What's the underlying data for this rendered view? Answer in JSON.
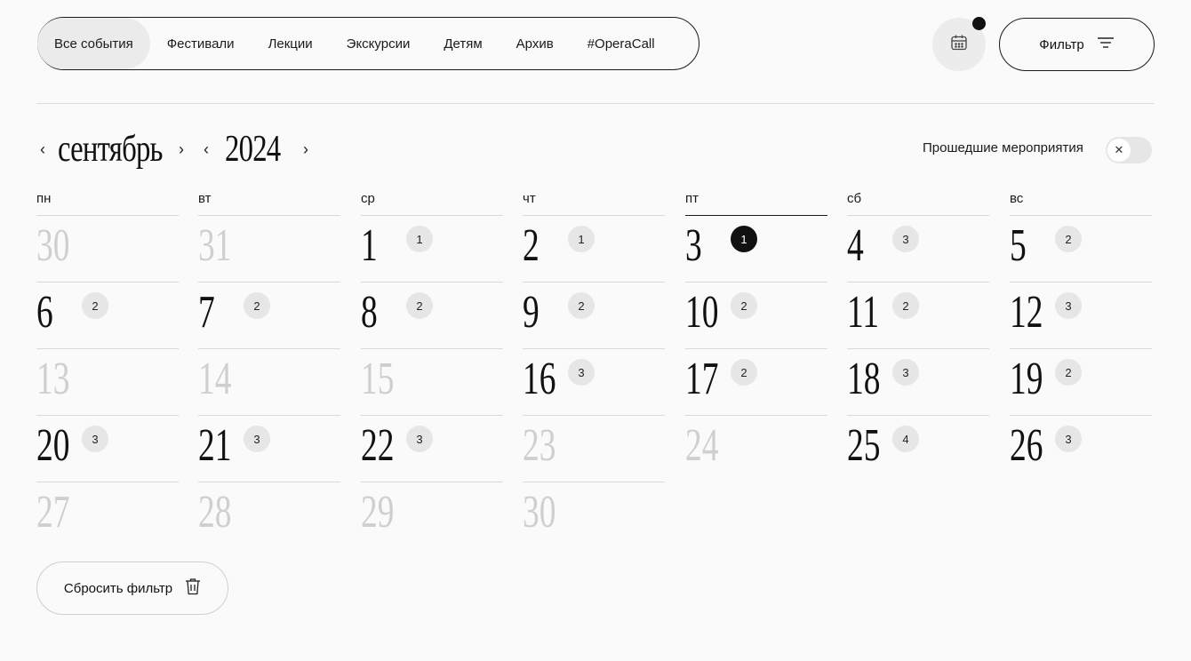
{
  "tabs": [
    {
      "label": "Все события",
      "active": true
    },
    {
      "label": "Фестивали",
      "active": false
    },
    {
      "label": "Лекции",
      "active": false
    },
    {
      "label": "Экскурсии",
      "active": false
    },
    {
      "label": "Детям",
      "active": false
    },
    {
      "label": "Архив",
      "active": false
    },
    {
      "label": "#OperaCall",
      "active": false
    }
  ],
  "filter_label": "Фильтр",
  "calendar_icon": "calendar-icon",
  "month": "сентябрь",
  "year": "2024",
  "past_events_label": "Прошедшие мероприятия",
  "past_events_toggle": "off",
  "weekdays": [
    "пн",
    "вт",
    "ср",
    "чт",
    "пт",
    "сб",
    "вс"
  ],
  "weeks": [
    [
      {
        "day": "30",
        "dim": true,
        "count": ""
      },
      {
        "day": "31",
        "dim": true,
        "count": ""
      },
      {
        "day": "1",
        "dim": false,
        "count": "1"
      },
      {
        "day": "2",
        "dim": false,
        "count": "1"
      },
      {
        "day": "3",
        "dim": false,
        "count": "1",
        "active": true
      },
      {
        "day": "4",
        "dim": false,
        "count": "3"
      },
      {
        "day": "5",
        "dim": false,
        "count": "2"
      }
    ],
    [
      {
        "day": "6",
        "dim": false,
        "count": "2"
      },
      {
        "day": "7",
        "dim": false,
        "count": "2"
      },
      {
        "day": "8",
        "dim": false,
        "count": "2"
      },
      {
        "day": "9",
        "dim": false,
        "count": "2"
      },
      {
        "day": "10",
        "dim": false,
        "count": "2"
      },
      {
        "day": "11",
        "dim": false,
        "count": "2"
      },
      {
        "day": "12",
        "dim": false,
        "count": "3"
      }
    ],
    [
      {
        "day": "13",
        "dim": true,
        "count": ""
      },
      {
        "day": "14",
        "dim": true,
        "count": ""
      },
      {
        "day": "15",
        "dim": true,
        "count": ""
      },
      {
        "day": "16",
        "dim": false,
        "count": "3"
      },
      {
        "day": "17",
        "dim": false,
        "count": "2"
      },
      {
        "day": "18",
        "dim": false,
        "count": "3"
      },
      {
        "day": "19",
        "dim": false,
        "count": "2"
      }
    ],
    [
      {
        "day": "20",
        "dim": false,
        "count": "3"
      },
      {
        "day": "21",
        "dim": false,
        "count": "3"
      },
      {
        "day": "22",
        "dim": false,
        "count": "3"
      },
      {
        "day": "23",
        "dim": true,
        "count": ""
      },
      {
        "day": "24",
        "dim": true,
        "count": ""
      },
      {
        "day": "25",
        "dim": false,
        "count": "4"
      },
      {
        "day": "26",
        "dim": false,
        "count": "3"
      }
    ],
    [
      {
        "day": "27",
        "dim": true,
        "count": ""
      },
      {
        "day": "28",
        "dim": true,
        "count": ""
      },
      {
        "day": "29",
        "dim": true,
        "count": ""
      },
      {
        "day": "30",
        "dim": true,
        "count": ""
      }
    ]
  ],
  "reset_label": "Сбросить фильтр"
}
